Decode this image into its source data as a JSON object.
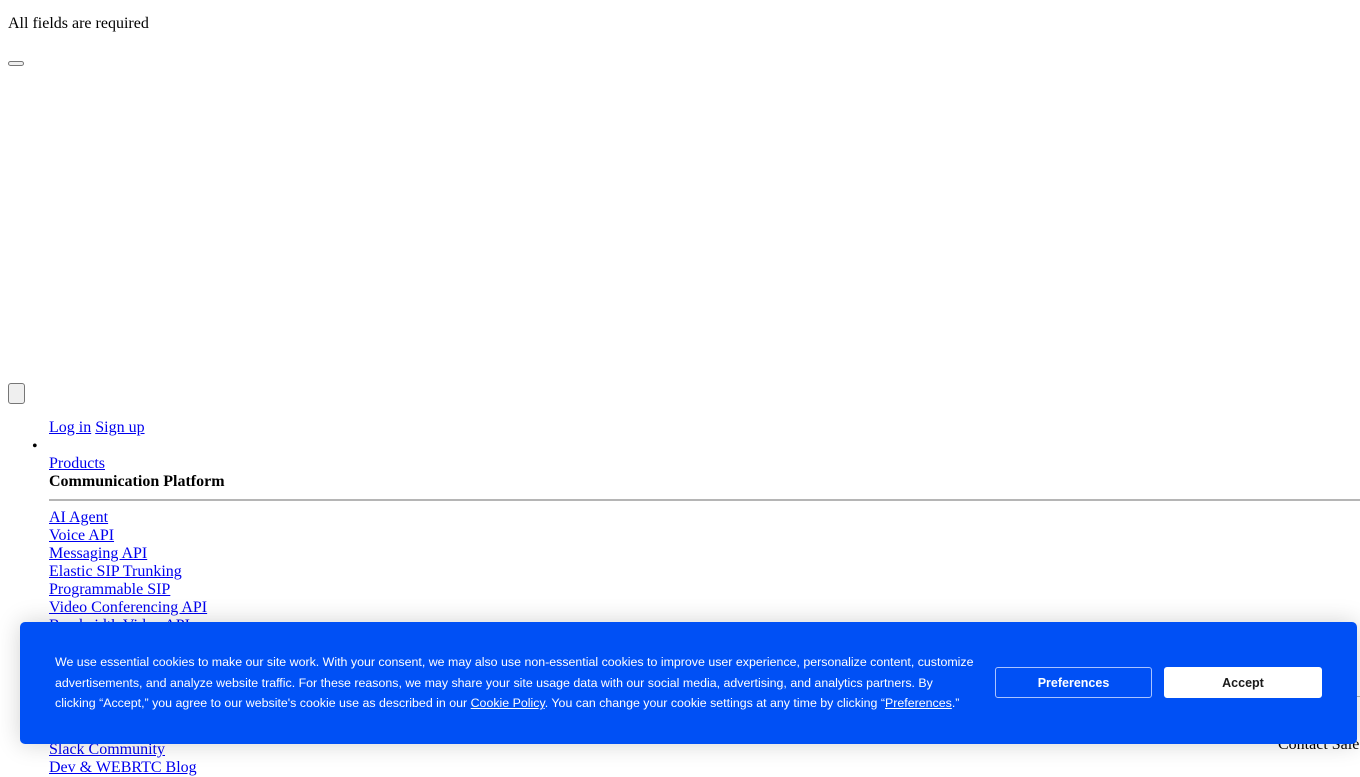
{
  "form": {
    "required_notice": "All fields are required"
  },
  "header": {
    "login_label": "Log in",
    "signup_label": "Sign up"
  },
  "nav": {
    "products_label": "Products",
    "section_heading": "Communication Platform",
    "items": [
      "AI Agent",
      "Voice API",
      "Messaging API",
      "Elastic SIP Trunking",
      "Programmable SIP",
      "Video Conferencing API",
      "Bandwidth Video API"
    ],
    "lower_items": [
      "Slack Community",
      "Dev & WEBRTC Blog"
    ],
    "contact_sales_label": "Contact Sales"
  },
  "cookie_banner": {
    "background_color": "#0050f5",
    "text_before_policy": "We use essential cookies to make our site work. With your consent, we may also use non-essential cookies to improve user experience, personalize content, customize advertisements, and analyze website traffic. For these reasons, we may share your site usage data with our social media, advertising, and analytics partners. By clicking “Accept,” you agree to our website's cookie use as described in our ",
    "policy_link": "Cookie Policy",
    "text_middle": ". You can change your cookie settings at any time by clicking “",
    "preferences_link": "Preferences",
    "text_end": ".”",
    "preferences_button": "Preferences",
    "accept_button": "Accept"
  }
}
